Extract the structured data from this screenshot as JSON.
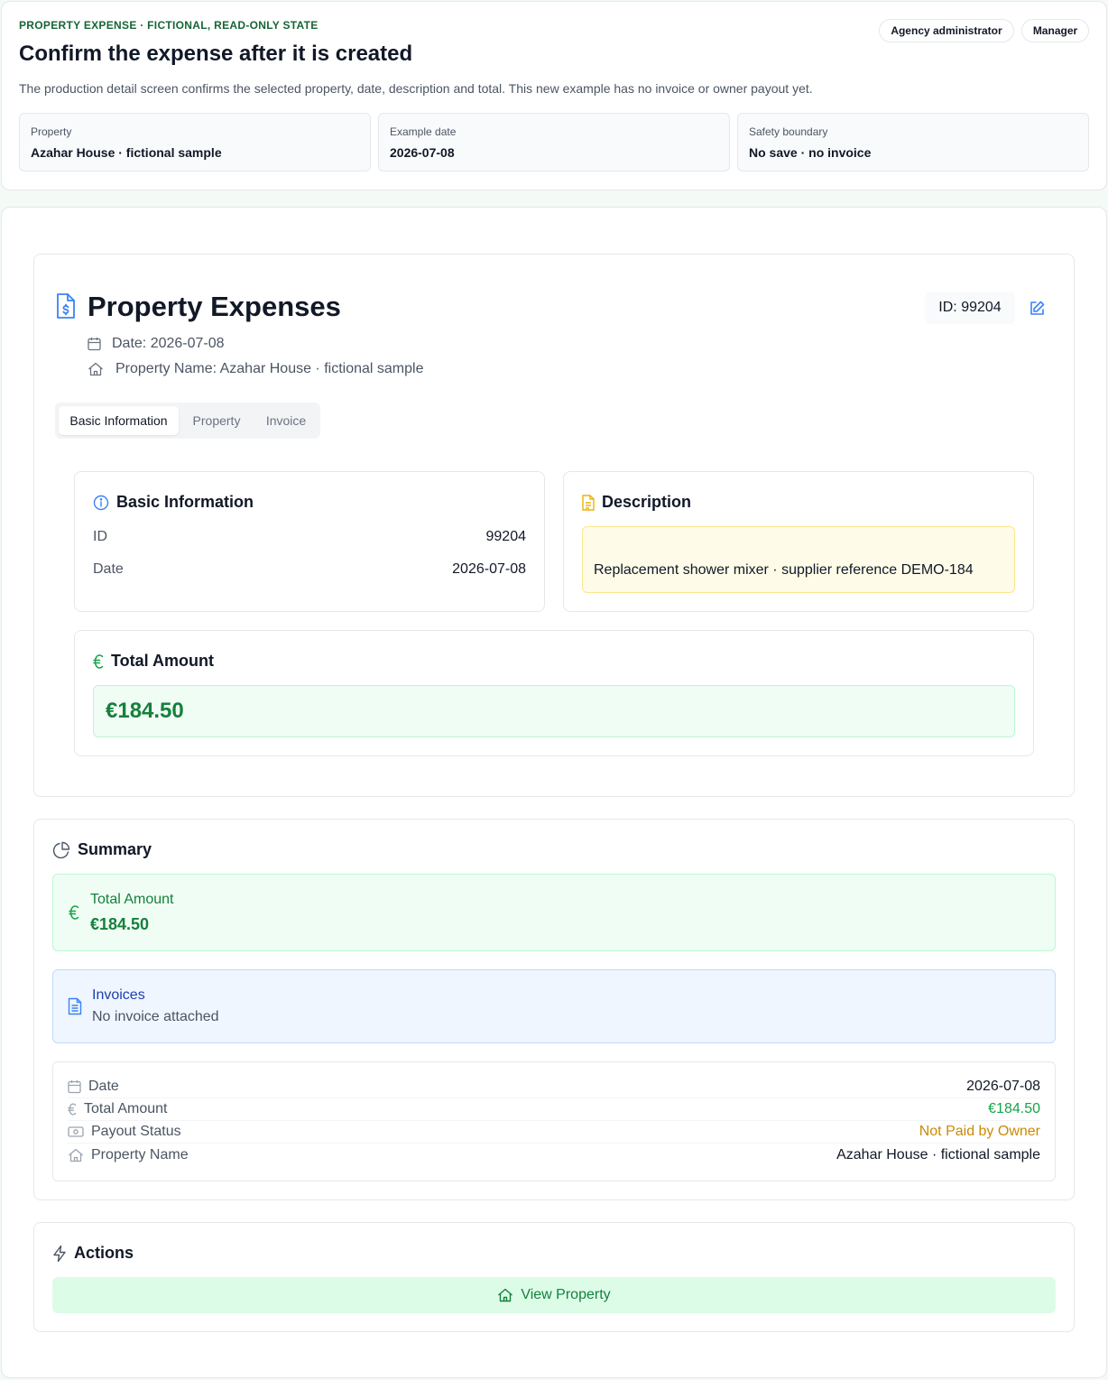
{
  "banner": {
    "eyebrow": "PROPERTY EXPENSE · FICTIONAL, READ-ONLY STATE",
    "title": "Confirm the expense after it is created",
    "description": "The production detail screen confirms the selected property, date, description and total. This new example has no invoice or owner payout yet.",
    "roles": [
      "Agency administrator",
      "Manager"
    ],
    "facts": [
      {
        "label": "Property",
        "value": "Azahar House · fictional sample"
      },
      {
        "label": "Example date",
        "value": "2026-07-08"
      },
      {
        "label": "Safety boundary",
        "value": "No save · no invoice"
      }
    ]
  },
  "detail": {
    "title": "Property Expenses",
    "date_line": "Date: 2026-07-08",
    "property_line": "Property Name: Azahar House · fictional sample",
    "id_chip": "ID: 99204",
    "tabs": [
      "Basic Information",
      "Property",
      "Invoice"
    ],
    "basic": {
      "title": "Basic Information",
      "rows": [
        {
          "label": "ID",
          "value": "99204"
        },
        {
          "label": "Date",
          "value": "2026-07-08"
        }
      ]
    },
    "description": {
      "title": "Description",
      "text": "Replacement shower mixer · supplier reference DEMO-184"
    },
    "total": {
      "title": "Total Amount",
      "value": "€184.50"
    }
  },
  "summary": {
    "title": "Summary",
    "total_label": "Total Amount",
    "total_value": "€184.50",
    "invoices_label": "Invoices",
    "invoices_value": "No invoice attached",
    "rows": [
      {
        "label": "Date",
        "value": "2026-07-08"
      },
      {
        "label": "Total Amount",
        "value": "€184.50"
      },
      {
        "label": "Payout Status",
        "value": "Not Paid by Owner"
      },
      {
        "label": "Property Name",
        "value": "Azahar House · fictional sample"
      }
    ]
  },
  "actions": {
    "title": "Actions",
    "view_property": "View Property"
  },
  "colors": {
    "accent_green": "#15803d",
    "status_amber": "#ca8a04",
    "info_blue": "#1e40af"
  }
}
